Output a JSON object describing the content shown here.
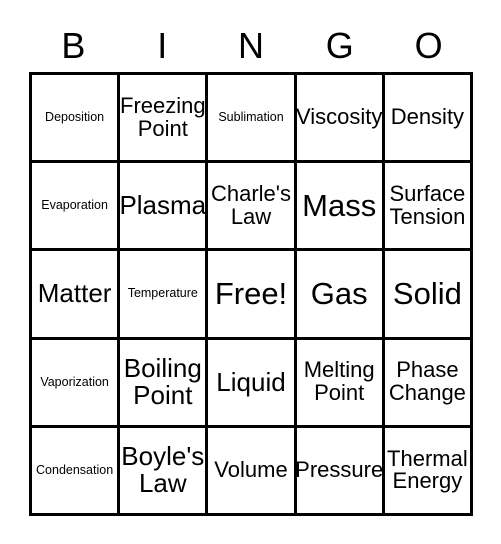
{
  "card": {
    "title": "BINGO",
    "header_letters": [
      "B",
      "I",
      "N",
      "G",
      "O"
    ],
    "free_space_label": "Free!",
    "colors": {
      "background": "#ffffff",
      "border": "#000000",
      "text": "#000000"
    },
    "grid": {
      "columns": 5,
      "rows": 5,
      "cells": [
        [
          {
            "label": "Deposition",
            "size": "xs"
          },
          {
            "label": "Freezing Point",
            "size": "md"
          },
          {
            "label": "Sublimation",
            "size": "xs"
          },
          {
            "label": "Viscosity",
            "size": "md"
          },
          {
            "label": "Density",
            "size": "md"
          }
        ],
        [
          {
            "label": "Evaporation",
            "size": "xs"
          },
          {
            "label": "Plasma",
            "size": "lg"
          },
          {
            "label": "Charle's Law",
            "size": "md"
          },
          {
            "label": "Mass",
            "size": "xl"
          },
          {
            "label": "Surface Tension",
            "size": "md"
          }
        ],
        [
          {
            "label": "Matter",
            "size": "lg"
          },
          {
            "label": "Temperature",
            "size": "xs"
          },
          {
            "label": "Free!",
            "size": "xl"
          },
          {
            "label": "Gas",
            "size": "xl"
          },
          {
            "label": "Solid",
            "size": "xl"
          }
        ],
        [
          {
            "label": "Vaporization",
            "size": "xs"
          },
          {
            "label": "Boiling Point",
            "size": "lg"
          },
          {
            "label": "Liquid",
            "size": "lg"
          },
          {
            "label": "Melting Point",
            "size": "md"
          },
          {
            "label": "Phase Change",
            "size": "md"
          }
        ],
        [
          {
            "label": "Condensation",
            "size": "xs"
          },
          {
            "label": "Boyle's Law",
            "size": "lg"
          },
          {
            "label": "Volume",
            "size": "md"
          },
          {
            "label": "Pressure",
            "size": "md"
          },
          {
            "label": "Thermal Energy",
            "size": "md"
          }
        ]
      ]
    }
  }
}
